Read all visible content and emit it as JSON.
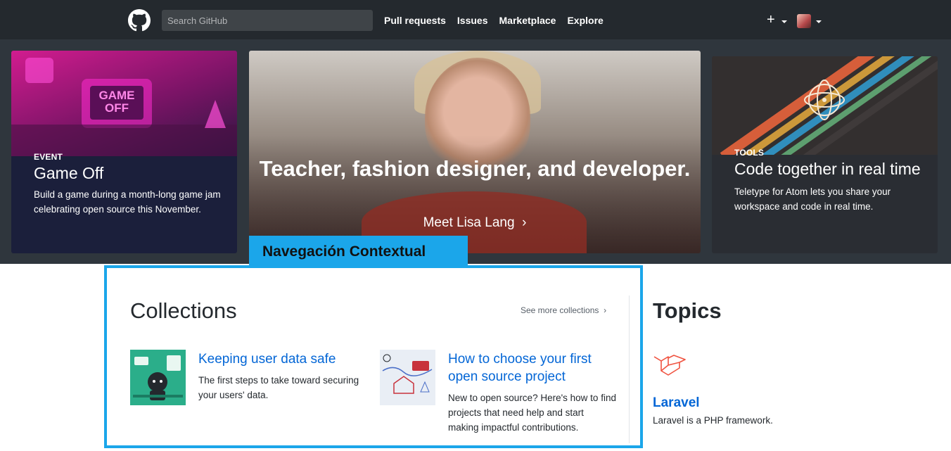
{
  "header": {
    "search_placeholder": "Search GitHub",
    "nav": [
      "Pull requests",
      "Issues",
      "Marketplace",
      "Explore"
    ],
    "plus_label": "+"
  },
  "hero": {
    "left": {
      "eyebrow": "EVENT",
      "title": "Game Off",
      "description": "Build a game during a month-long game jam celebrating open source this November.",
      "art_text": "GAME OFF"
    },
    "center": {
      "title": "Teacher, fashion designer, and developer.",
      "link": "Meet Lisa Lang"
    },
    "right": {
      "eyebrow": "TOOLS",
      "title": "Code together in real time",
      "description": "Teletype for Atom lets you share your workspace and code in real time."
    }
  },
  "overlay": {
    "label": "Navegación Contextual",
    "accent": "#1ba6ea"
  },
  "collections": {
    "title": "Collections",
    "see_more": "See more collections",
    "items": [
      {
        "title": "Keeping user data safe",
        "description": "The first steps to take toward securing your users' data."
      },
      {
        "title": "How to choose your first open source project",
        "description": "New to open source? Here's how to find projects that need help and start making impactful contributions."
      }
    ]
  },
  "topics": {
    "title": "Topics",
    "items": [
      {
        "name": "Laravel",
        "description": "Laravel is a PHP framework."
      }
    ]
  },
  "colors": {
    "header_bg": "#24292e",
    "hero_bg": "#2f363d",
    "link": "#0366d6"
  }
}
